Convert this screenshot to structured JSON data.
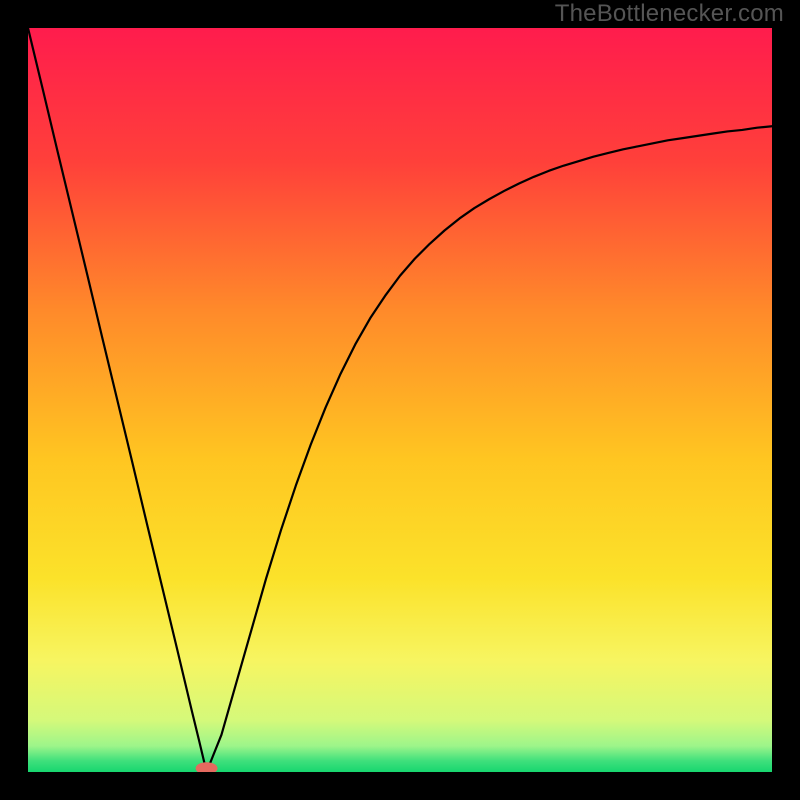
{
  "watermark": "TheBottlenecker.com",
  "chart_data": {
    "type": "line",
    "title": "",
    "xlabel": "",
    "ylabel": "",
    "xlim": [
      0,
      100
    ],
    "ylim": [
      0,
      100
    ],
    "grid": false,
    "background_gradient_stops": [
      {
        "offset": 0.0,
        "color": "#ff1c4d"
      },
      {
        "offset": 0.18,
        "color": "#ff403a"
      },
      {
        "offset": 0.38,
        "color": "#ff8a2a"
      },
      {
        "offset": 0.58,
        "color": "#ffc621"
      },
      {
        "offset": 0.74,
        "color": "#fbe22a"
      },
      {
        "offset": 0.85,
        "color": "#f7f561"
      },
      {
        "offset": 0.93,
        "color": "#d5f97a"
      },
      {
        "offset": 0.965,
        "color": "#9df58a"
      },
      {
        "offset": 0.985,
        "color": "#3fe07c"
      },
      {
        "offset": 1.0,
        "color": "#17d66f"
      }
    ],
    "optimum_marker": {
      "x": 24,
      "y": 0.5,
      "color": "#e46a5f"
    },
    "series": [
      {
        "name": "bottleneck-curve",
        "color": "#000000",
        "x": [
          0,
          2,
          4,
          6,
          8,
          10,
          12,
          14,
          16,
          18,
          20,
          22,
          23,
          24,
          25,
          26,
          28,
          30,
          32,
          34,
          36,
          38,
          40,
          42,
          44,
          46,
          48,
          50,
          52,
          54,
          56,
          58,
          60,
          62,
          64,
          66,
          68,
          70,
          72,
          74,
          76,
          78,
          80,
          82,
          84,
          86,
          88,
          90,
          92,
          94,
          96,
          98,
          100
        ],
        "values": [
          100,
          91.7,
          83.3,
          75.0,
          66.7,
          58.3,
          50.0,
          41.7,
          33.3,
          25.0,
          16.7,
          8.3,
          4.2,
          0.0,
          2.5,
          5.0,
          12.0,
          19.0,
          26.0,
          32.5,
          38.5,
          44.0,
          49.0,
          53.5,
          57.5,
          61.0,
          64.0,
          66.7,
          69.0,
          71.0,
          72.8,
          74.4,
          75.8,
          77.0,
          78.1,
          79.1,
          80.0,
          80.8,
          81.5,
          82.1,
          82.7,
          83.2,
          83.7,
          84.1,
          84.5,
          84.9,
          85.2,
          85.5,
          85.8,
          86.1,
          86.3,
          86.6,
          86.8
        ]
      }
    ]
  }
}
